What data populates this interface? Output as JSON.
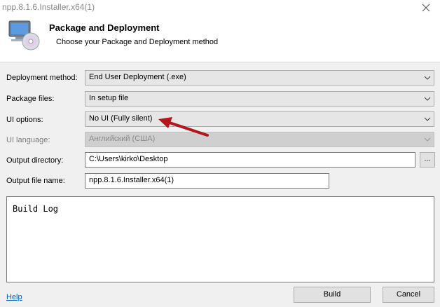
{
  "window": {
    "title": "npp.8.1.6.Installer.x64(1)"
  },
  "header": {
    "title": "Package and Deployment",
    "subtitle": "Choose your Package and Deployment method"
  },
  "form": {
    "deployment_method": {
      "label": "Deployment method:",
      "value": "End User Deployment (.exe)"
    },
    "package_files": {
      "label": "Package files:",
      "value": "In setup file"
    },
    "ui_options": {
      "label": "UI options:",
      "value": "No UI (Fully silent)"
    },
    "ui_language": {
      "label": "UI language:",
      "value": "Английский (США)"
    },
    "output_directory": {
      "label": "Output directory:",
      "value": "C:\\Users\\kirko\\Desktop",
      "browse_label": "..."
    },
    "output_file_name": {
      "label": "Output file name:",
      "value": "npp.8.1.6.Installer.x64(1)"
    }
  },
  "build_log": {
    "text": "Build Log"
  },
  "footer": {
    "help_label": "Help",
    "build_label": "Build",
    "cancel_label": "Cancel"
  },
  "icons": {
    "app": "computer-disc-icon",
    "close": "close-icon",
    "chevron": "chevron-down-icon",
    "annotation": "red-arrow"
  },
  "colors": {
    "annotation_arrow": "#b3161b",
    "link": "#0066cc"
  }
}
